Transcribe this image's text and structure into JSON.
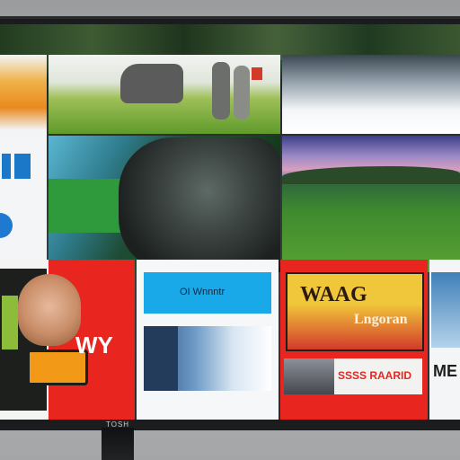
{
  "device": {
    "brand_label": "TOSH",
    "colors": {
      "bezel": "#1b1c1e",
      "accent_red": "#e8261f",
      "accent_blue": "#19a8e8",
      "banner_yellow": "#f0c63a"
    }
  },
  "tiles": {
    "left_column": {
      "icon": "app-grid-icon"
    },
    "poster_left": {
      "caption": "WY"
    },
    "promo_blue": {
      "label": "OI Wnnntr"
    },
    "promo_red": {
      "heading": "WAAG",
      "subtitle": "Lngoran",
      "footer": "SSSS RAARID"
    },
    "promo_right": {
      "text": "ME"
    }
  }
}
